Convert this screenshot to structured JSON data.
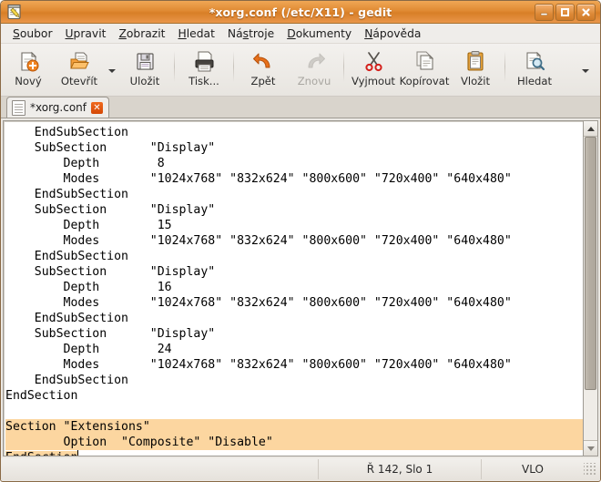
{
  "window": {
    "title": "*xorg.conf (/etc/X11) - gedit",
    "app_icon": "gedit-notepad-pencil-icon",
    "buttons": {
      "minimize": "_",
      "maximize": "□",
      "close": "✕"
    }
  },
  "menubar": {
    "items": [
      {
        "label": "Soubor",
        "mnemonic": "S"
      },
      {
        "label": "Upravit",
        "mnemonic": "U"
      },
      {
        "label": "Zobrazit",
        "mnemonic": "Z"
      },
      {
        "label": "Hledat",
        "mnemonic": "H"
      },
      {
        "label": "Nástroje",
        "mnemonic": "t"
      },
      {
        "label": "Dokumenty",
        "mnemonic": "D"
      },
      {
        "label": "Nápověda",
        "mnemonic": "N"
      }
    ]
  },
  "toolbar": {
    "items": [
      {
        "label": "Nový",
        "icon": "new-document-icon",
        "disabled": false
      },
      {
        "label": "Otevřít",
        "icon": "open-folder-icon",
        "disabled": false
      },
      {
        "label": "Uložit",
        "icon": "save-floppy-icon",
        "disabled": false
      },
      {
        "label": "Tisk...",
        "icon": "print-icon",
        "disabled": false
      },
      {
        "label": "Zpět",
        "icon": "undo-arrow-icon",
        "disabled": false
      },
      {
        "label": "Znovu",
        "icon": "redo-arrow-icon",
        "disabled": true
      },
      {
        "label": "Vyjmout",
        "icon": "scissors-icon",
        "disabled": false
      },
      {
        "label": "Kopírovat",
        "icon": "copy-pages-icon",
        "disabled": false
      },
      {
        "label": "Vložit",
        "icon": "paste-clipboard-icon",
        "disabled": false
      },
      {
        "label": "Hledat",
        "icon": "search-magnifier-icon",
        "disabled": false
      }
    ]
  },
  "tabs": [
    {
      "label": "*xorg.conf",
      "icon": "text-file-icon",
      "close": "✕",
      "active": true
    }
  ],
  "editor": {
    "lines": [
      {
        "text": "    EndSubSection",
        "selected": false,
        "clipped": true
      },
      {
        "text": "    SubSection      \"Display\"",
        "selected": false
      },
      {
        "text": "        Depth        8",
        "selected": false
      },
      {
        "text": "        Modes       \"1024x768\" \"832x624\" \"800x600\" \"720x400\" \"640x480\"",
        "selected": false
      },
      {
        "text": "    EndSubSection",
        "selected": false
      },
      {
        "text": "    SubSection      \"Display\"",
        "selected": false
      },
      {
        "text": "        Depth        15",
        "selected": false
      },
      {
        "text": "        Modes       \"1024x768\" \"832x624\" \"800x600\" \"720x400\" \"640x480\"",
        "selected": false
      },
      {
        "text": "    EndSubSection",
        "selected": false
      },
      {
        "text": "    SubSection      \"Display\"",
        "selected": false
      },
      {
        "text": "        Depth        16",
        "selected": false
      },
      {
        "text": "        Modes       \"1024x768\" \"832x624\" \"800x600\" \"720x400\" \"640x480\"",
        "selected": false
      },
      {
        "text": "    EndSubSection",
        "selected": false
      },
      {
        "text": "    SubSection      \"Display\"",
        "selected": false
      },
      {
        "text": "        Depth        24",
        "selected": false
      },
      {
        "text": "        Modes       \"1024x768\" \"832x624\" \"800x600\" \"720x400\" \"640x480\"",
        "selected": false
      },
      {
        "text": "    EndSubSection",
        "selected": false
      },
      {
        "text": "EndSection",
        "selected": false
      },
      {
        "text": "",
        "selected": false
      },
      {
        "text": "Section \"Extensions\"",
        "selected": true,
        "full_width": true
      },
      {
        "text": "        Option  \"Composite\" \"Disable\"",
        "selected": true,
        "full_width": true
      },
      {
        "text": "EndSection",
        "selected": true,
        "full_width": false,
        "caret_after": true
      }
    ],
    "selection_color": "#fcd6a0",
    "background_color": "#ffffff",
    "text_color": "#000000"
  },
  "scrollbar": {
    "up_arrow": "▲",
    "down_arrow": "▼",
    "thumb_top_percent": 0,
    "thumb_height_percent": 83
  },
  "statusbar": {
    "position": "Ř 142, Slo 1",
    "insert_mode": "VLO"
  },
  "colors": {
    "titlebar_orange": "#e08a33",
    "selection_peach": "#fcd6a0",
    "chrome_grey": "#ece9e4"
  }
}
